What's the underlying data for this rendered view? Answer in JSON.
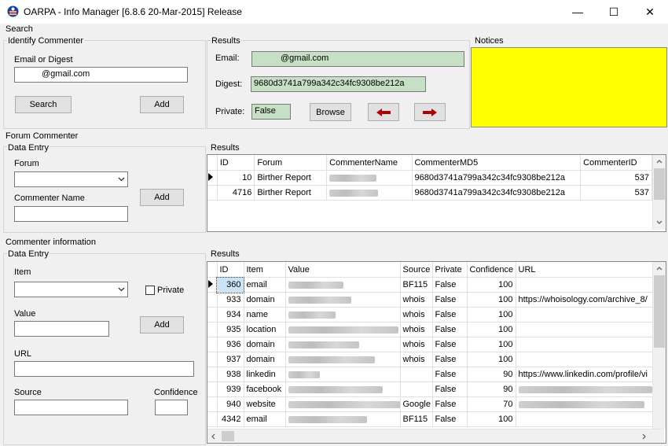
{
  "window": {
    "title": "OARPA - Info Manager [6.8.6 20-Mar-2015] Release",
    "minimize": "—",
    "maximize": "☐",
    "close": "✕"
  },
  "search": {
    "section_label": "Search",
    "identify": {
      "label": "Identify Commenter",
      "email_label": "Email or Digest",
      "email_value": "@gmail.com",
      "search_button": "Search",
      "add_button": "Add"
    },
    "results": {
      "label": "Results",
      "email_label": "Email:",
      "email_value": "@gmail.com",
      "digest_label": "Digest:",
      "digest_value": "9680d3741a799a342c34fc9308be212a",
      "private_label": "Private:",
      "private_value": "False",
      "browse_button": "Browse"
    },
    "notices": {
      "label": "Notices",
      "color": "#ffff00"
    }
  },
  "forum": {
    "section_label": "Forum Commenter",
    "entry": {
      "label": "Data Entry",
      "forum_label": "Forum",
      "forum_value": "",
      "name_label": "Commenter Name",
      "name_value": "",
      "add_button": "Add"
    },
    "results": {
      "label": "Results",
      "columns": [
        "ID",
        "Forum",
        "CommenterName",
        "CommenterMD5",
        "CommenterID"
      ],
      "rows": [
        {
          "id": "10",
          "forum": "Birther Report",
          "name": "",
          "md5": "9680d3741a799a342c34fc9308be212a",
          "cid": "537"
        },
        {
          "id": "4716",
          "forum": "Birther Report",
          "name": "",
          "md5": "9680d3741a799a342c34fc9308be212a",
          "cid": "537"
        }
      ]
    }
  },
  "info": {
    "section_label": "Commenter information",
    "entry": {
      "label": "Data Entry",
      "item_label": "Item",
      "item_value": "",
      "private_label": "Private",
      "value_label": "Value",
      "value_value": "",
      "add_button": "Add",
      "url_label": "URL",
      "url_value": "",
      "source_label": "Source",
      "source_value": "",
      "confidence_label": "Confidence",
      "confidence_value": ""
    },
    "results": {
      "label": "Results",
      "columns": [
        "ID",
        "Item",
        "Value",
        "Source",
        "Private",
        "Confidence",
        "URL"
      ],
      "rows": [
        {
          "id": "360",
          "item": "email",
          "source": "BF115",
          "private": "False",
          "confidence": "100",
          "url": ""
        },
        {
          "id": "933",
          "item": "domain",
          "source": "whois",
          "private": "False",
          "confidence": "100",
          "url": "https://whoisology.com/archive_8/"
        },
        {
          "id": "934",
          "item": "name",
          "source": "whois",
          "private": "False",
          "confidence": "100",
          "url": ""
        },
        {
          "id": "935",
          "item": "location",
          "source": "whois",
          "private": "False",
          "confidence": "100",
          "url": ""
        },
        {
          "id": "936",
          "item": "domain",
          "source": "whois",
          "private": "False",
          "confidence": "100",
          "url": ""
        },
        {
          "id": "937",
          "item": "domain",
          "source": "whois",
          "private": "False",
          "confidence": "100",
          "url": ""
        },
        {
          "id": "938",
          "item": "linkedin",
          "source": "",
          "private": "False",
          "confidence": "90",
          "url": "https://www.linkedin.com/profile/vi"
        },
        {
          "id": "939",
          "item": "facebook",
          "source": "",
          "private": "False",
          "confidence": "90",
          "url": ""
        },
        {
          "id": "940",
          "item": "website",
          "source": "Google",
          "private": "False",
          "confidence": "70",
          "url": ""
        },
        {
          "id": "4342",
          "item": "email",
          "source": "BF115",
          "private": "False",
          "confidence": "100",
          "url": ""
        }
      ]
    }
  }
}
